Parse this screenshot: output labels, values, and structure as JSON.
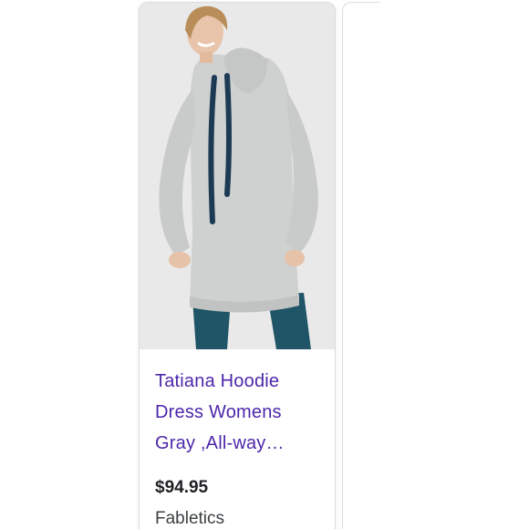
{
  "product": {
    "title_line1": "Tatiana Hoodie",
    "title_line2": "Dress Womens",
    "title_line3": "Gray ,All-way…",
    "price": "$94.95",
    "merchant": "Fabletics"
  },
  "colors": {
    "title": "#4d27aa",
    "price": "#202124",
    "merchant": "#3c4043",
    "image_bg": "#e9e9ea",
    "hoodie_gray": "#cfd0d0",
    "leggings_teal": "#1f5566",
    "drawstring_navy": "#1d3a55"
  }
}
